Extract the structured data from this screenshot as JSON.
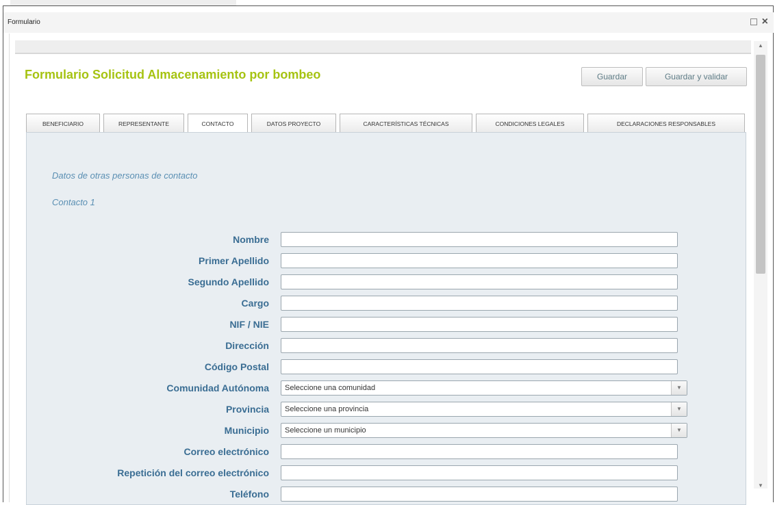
{
  "window": {
    "title": "Formulario"
  },
  "form": {
    "title": "Formulario Solicitud Almacenamiento por bombeo",
    "buttons": {
      "save": "Guardar",
      "save_validate": "Guardar y validar"
    }
  },
  "tabs": [
    {
      "label": "BENEFICIARIO"
    },
    {
      "label": "REPRESENTANTE"
    },
    {
      "label": "CONTACTO",
      "active": true
    },
    {
      "label": "DATOS PROYECTO"
    },
    {
      "label": "CARACTERÍSTICAS TÉCNICAS"
    },
    {
      "label": "CONDICIONES LEGALES"
    },
    {
      "label": "DECLARACIONES RESPONSABLES"
    }
  ],
  "section": {
    "heading": "Datos de otras personas de contacto",
    "subheading": "Contacto 1"
  },
  "fields": [
    {
      "label": "Nombre",
      "value": ""
    },
    {
      "label": "Primer Apellido",
      "value": ""
    },
    {
      "label": "Segundo Apellido",
      "value": ""
    },
    {
      "label": "Cargo",
      "value": ""
    },
    {
      "label": "NIF / NIE",
      "value": ""
    },
    {
      "label": "Dirección",
      "value": ""
    },
    {
      "label": "Código Postal",
      "value": ""
    },
    {
      "label": "Comunidad Autónoma",
      "value": "Seleccione una comunidad"
    },
    {
      "label": "Provincia",
      "value": "Seleccione una provincia"
    },
    {
      "label": "Municipio",
      "value": "Seleccione un municipio"
    },
    {
      "label": "Correo electrónico",
      "value": ""
    },
    {
      "label": "Repetición del correo electrónico",
      "value": ""
    },
    {
      "label": "Teléfono",
      "value": ""
    }
  ],
  "icons": {
    "restore": "restore-window-icon",
    "close": "close-icon",
    "dropdown": "chevron-down-icon"
  },
  "colors": {
    "title": "#a6c312",
    "label": "#3a6d93",
    "section": "#5a8fb3",
    "panel": "#e9eef2"
  }
}
